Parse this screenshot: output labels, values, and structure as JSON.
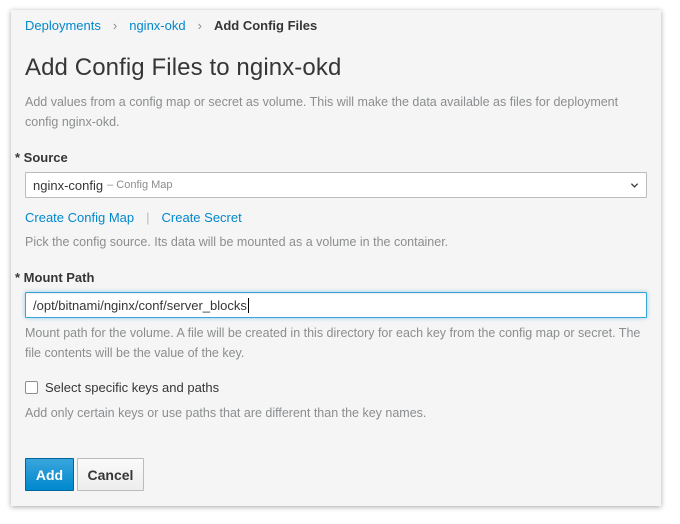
{
  "breadcrumb": {
    "items": [
      "Deployments",
      "nginx-okd"
    ],
    "current": "Add Config Files"
  },
  "page": {
    "title": "Add Config Files to nginx-okd",
    "description": "Add values from a config map or secret as volume. This will make the data available as files for deployment config nginx-okd."
  },
  "source": {
    "label": "* Source",
    "selected_value": "nginx-config",
    "selected_type": "– Config Map",
    "create_config_map": "Create Config Map",
    "separator": "|",
    "create_secret": "Create Secret",
    "help": "Pick the config source. Its data will be mounted as a volume in the container."
  },
  "mount_path": {
    "label": "* Mount Path",
    "value": "/opt/bitnami/nginx/conf/server_blocks",
    "help": "Mount path for the volume. A file will be created in this directory for each key from the config map or secret. The file contents will be the value of the key."
  },
  "keys": {
    "checkbox_label": "Select specific keys and paths",
    "checked": false,
    "help": "Add only certain keys or use paths that are different than the key names."
  },
  "actions": {
    "add": "Add",
    "cancel": "Cancel"
  },
  "colors": {
    "link": "#0088ce",
    "primary": "#0088ce",
    "background": "#f5f5f5"
  }
}
